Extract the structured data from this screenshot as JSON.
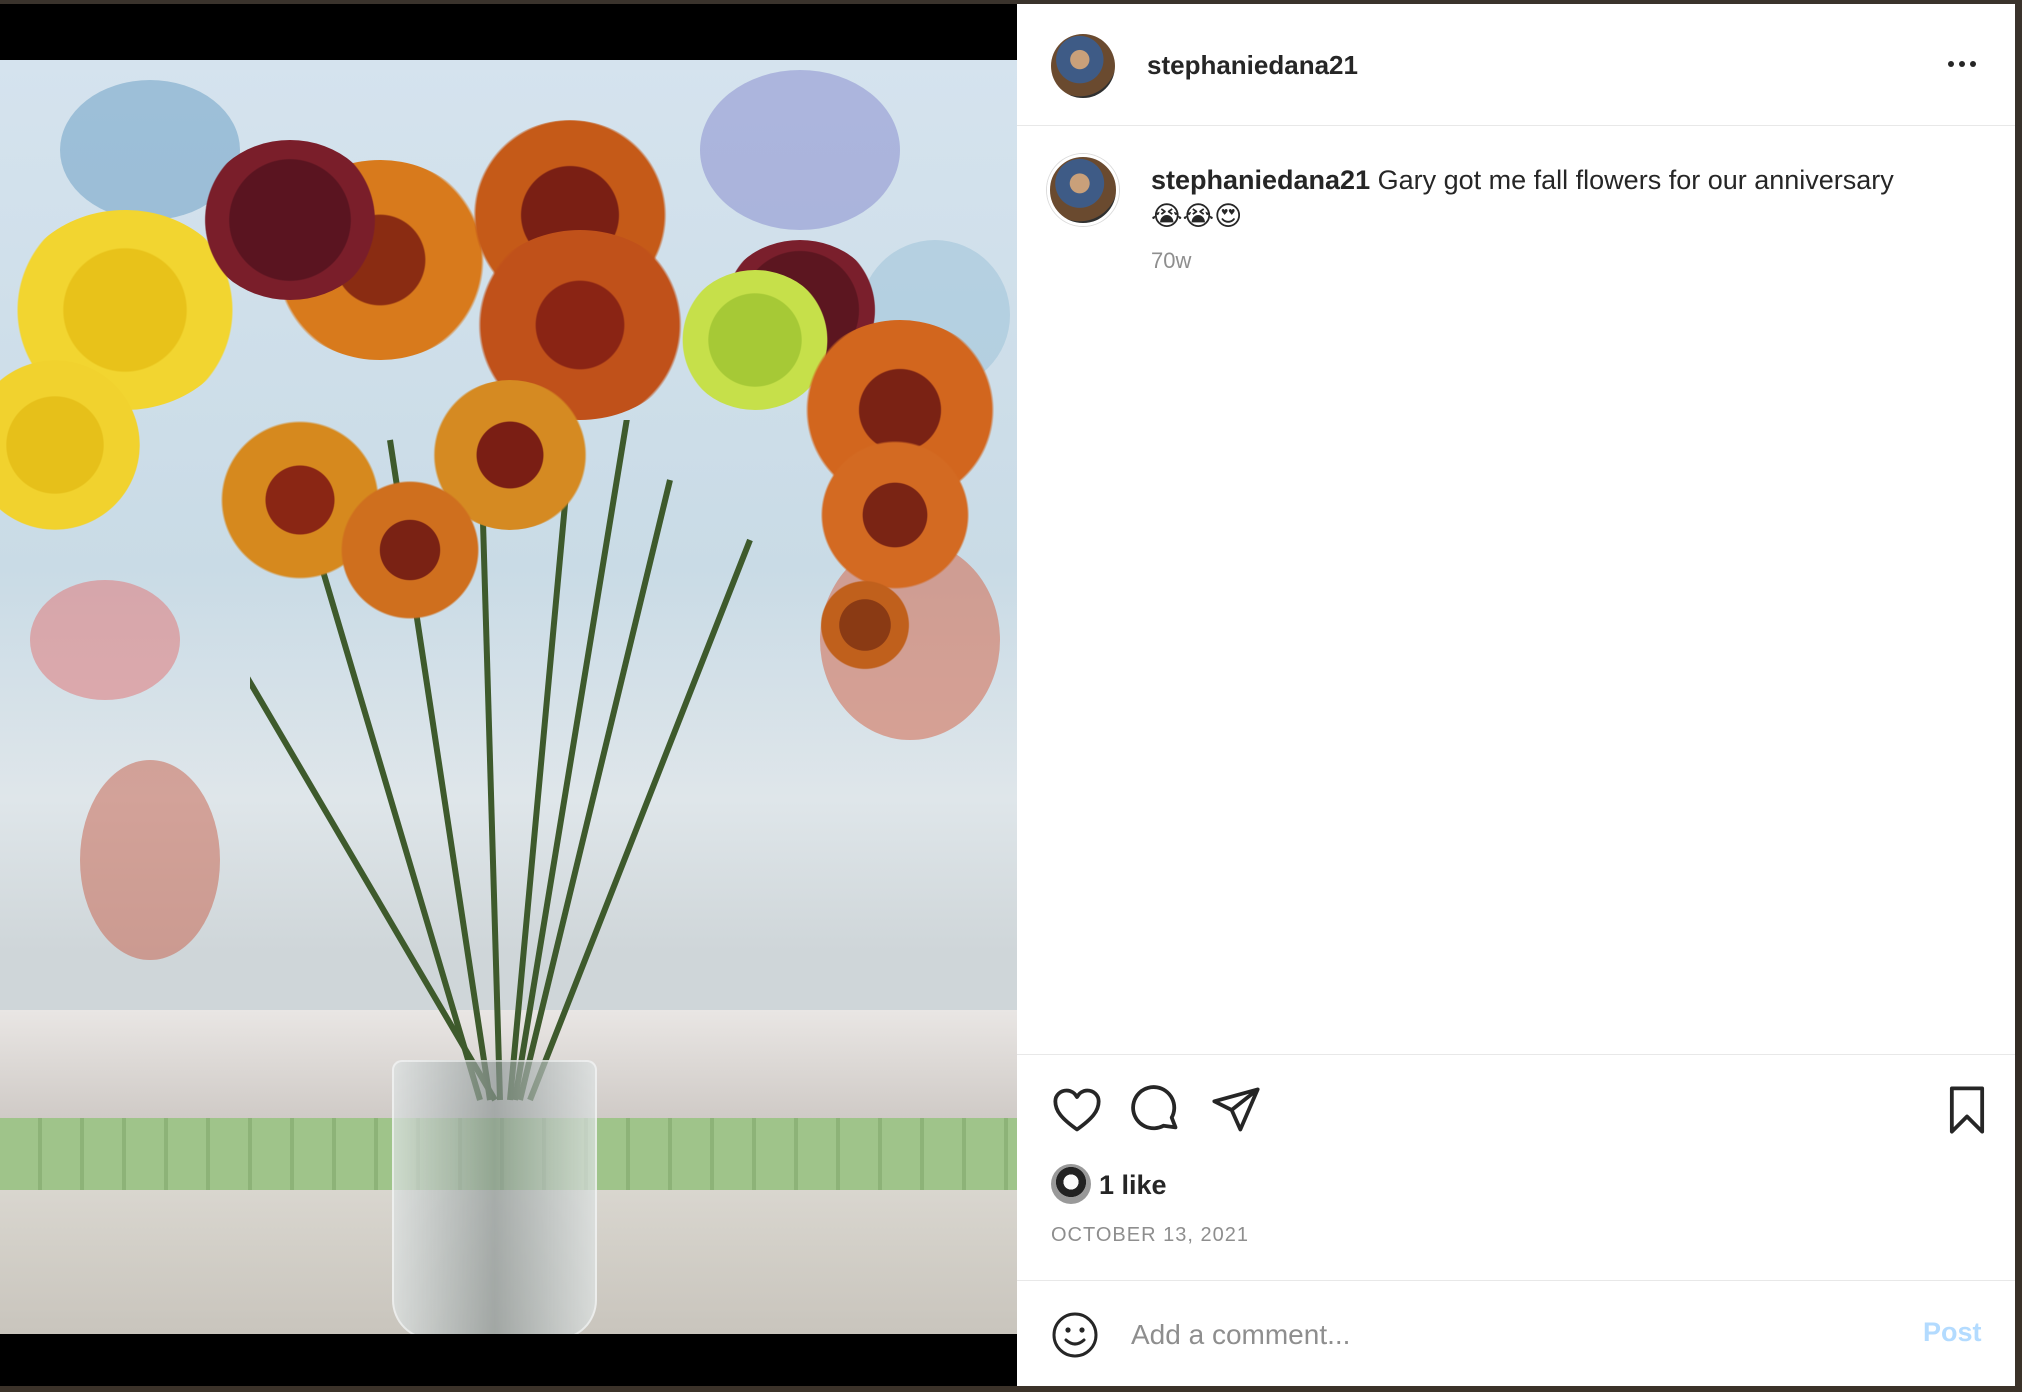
{
  "post": {
    "username": "stephaniedana21",
    "caption_text": " Gary got me fall flowers for our anniversary",
    "caption_emojis": "😭😭😍",
    "time_ago": "70w",
    "likes_label": "1 like",
    "date": "OCTOBER 13, 2021"
  },
  "comment": {
    "placeholder": "Add a comment...",
    "post_label": "Post"
  },
  "icons": {
    "more": "more-options-icon",
    "like": "heart-icon",
    "comment": "comment-bubble-icon",
    "share": "paper-plane-icon",
    "save": "bookmark-icon",
    "emoji": "smiley-icon"
  },
  "colors": {
    "text": "#262626",
    "secondary_text": "#8e8e8e",
    "post_button_disabled": "#b3dbff",
    "divider": "#e8e8e8"
  }
}
